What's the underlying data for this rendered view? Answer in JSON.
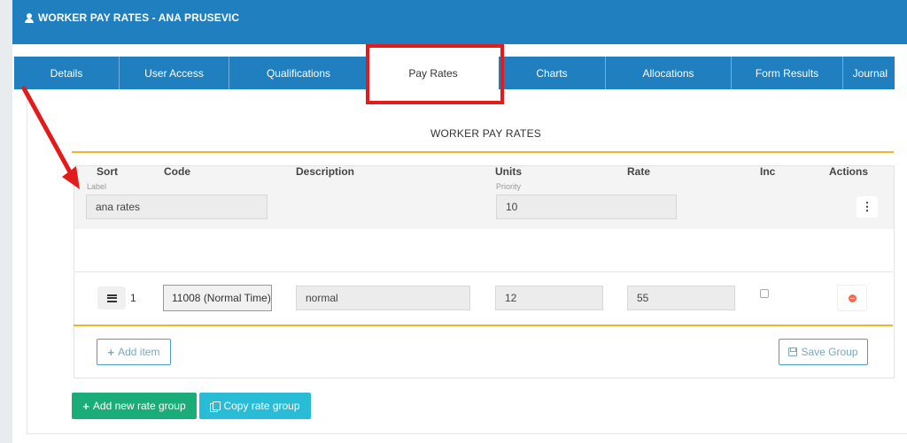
{
  "header": {
    "title": "WORKER PAY RATES - ANA PRUSEVIC",
    "icon": "user-icon"
  },
  "tabs": [
    {
      "label": "Details",
      "active": false
    },
    {
      "label": "User Access",
      "active": false
    },
    {
      "label": "Qualifications",
      "active": false
    },
    {
      "label": "Pay Rates",
      "active": true
    },
    {
      "label": "Charts",
      "active": false
    },
    {
      "label": "Allocations",
      "active": false
    },
    {
      "label": "Form Results",
      "active": false
    },
    {
      "label": "Journal",
      "active": false
    }
  ],
  "section_title": "WORKER PAY RATES",
  "group": {
    "label_caption": "Label",
    "label_value": "ana rates",
    "priority_caption": "Priority",
    "priority_value": "10",
    "menu_glyph": "⋮"
  },
  "table": {
    "headers": {
      "sort": "Sort",
      "code": "Code",
      "description": "Description",
      "units": "Units",
      "rate": "Rate",
      "inc": "Inc",
      "actions": "Actions"
    },
    "rows": [
      {
        "sort": "1",
        "code": "11008 (Normal Time)",
        "description": "normal",
        "units": "12",
        "rate": "55",
        "inc": false
      }
    ]
  },
  "buttons": {
    "add_item": "Add item",
    "save_group": "Save Group",
    "add_new_rate_group": "Add new rate group",
    "copy_rate_group": "Copy rate group"
  },
  "colors": {
    "primary": "#1f7fbf",
    "accent_gold": "#f0b429",
    "green": "#1aad7a",
    "teal": "#29bcd6",
    "danger": "#f26c4f",
    "annotation_red": "#e31b1b"
  }
}
